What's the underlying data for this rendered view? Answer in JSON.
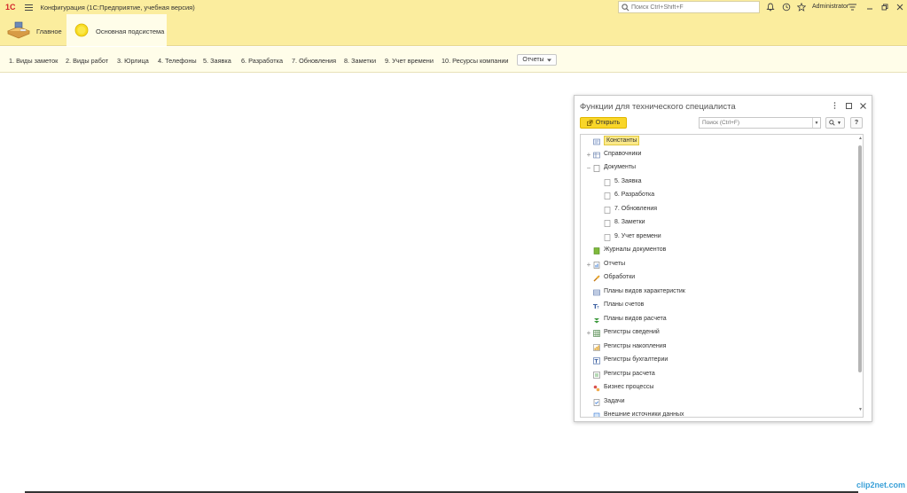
{
  "titlebar": {
    "logo": "1С",
    "title": "Конфигурация  (1С:Предприятие, учебная версия)",
    "search_placeholder": "Поиск Ctrl+Shift+F",
    "user": "Administrator"
  },
  "sections": [
    {
      "label": "Главное",
      "active": false
    },
    {
      "label": "Основная подсистема",
      "active": true
    }
  ],
  "functions": [
    "1. Виды заметок",
    "2. Виды работ",
    "3. Юрлица",
    "4. Телефоны",
    "5. Заявка",
    "6. Разработка",
    "7. Обновления",
    "8. Заметки",
    "9. Учет времени",
    "10. Ресурсы компании"
  ],
  "reports_button": "Отчеты",
  "window": {
    "title": "Функции для технического специалиста",
    "open_button": "Открыть",
    "search_placeholder": "Поиск (Ctrl+F)",
    "help_label": "?"
  },
  "tree": [
    {
      "label": "Константы",
      "icon": "constants-icon",
      "selected": true
    },
    {
      "label": "Справочники",
      "icon": "catalogs-icon",
      "expander": "+"
    },
    {
      "label": "Документы",
      "icon": "documents-icon",
      "expander": "−"
    },
    {
      "label": "5. Заявка",
      "icon": "document-icon",
      "child": true
    },
    {
      "label": "6. Разработка",
      "icon": "document-icon",
      "child": true
    },
    {
      "label": "7. Обновления",
      "icon": "document-icon",
      "child": true
    },
    {
      "label": "8. Заметки",
      "icon": "document-icon",
      "child": true
    },
    {
      "label": "9. Учет времени",
      "icon": "document-icon",
      "child": true
    },
    {
      "label": "Журналы документов",
      "icon": "journals-icon"
    },
    {
      "label": "Отчеты",
      "icon": "reports-icon",
      "expander": "+"
    },
    {
      "label": "Обработки",
      "icon": "processings-icon"
    },
    {
      "label": "Планы видов характеристик",
      "icon": "characteristic-plans-icon"
    },
    {
      "label": "Планы счетов",
      "icon": "chart-of-accounts-icon"
    },
    {
      "label": "Планы видов расчета",
      "icon": "calculation-plans-icon"
    },
    {
      "label": "Регистры сведений",
      "icon": "info-registers-icon",
      "expander": "+"
    },
    {
      "label": "Регистры накопления",
      "icon": "accumulation-registers-icon"
    },
    {
      "label": "Регистры бухгалтерии",
      "icon": "accounting-registers-icon"
    },
    {
      "label": "Регистры расчета",
      "icon": "calculation-registers-icon"
    },
    {
      "label": "Бизнес процессы",
      "icon": "business-processes-icon"
    },
    {
      "label": "Задачи",
      "icon": "tasks-icon"
    },
    {
      "label": "Внешние источники данных",
      "icon": "external-sources-icon"
    }
  ],
  "watermark": "clip2net.com",
  "colors": {
    "header_bg": "#fbed9e",
    "panel_bg": "#fffde9",
    "accent_button": "#f9d629",
    "brand_red": "#d2232a"
  }
}
